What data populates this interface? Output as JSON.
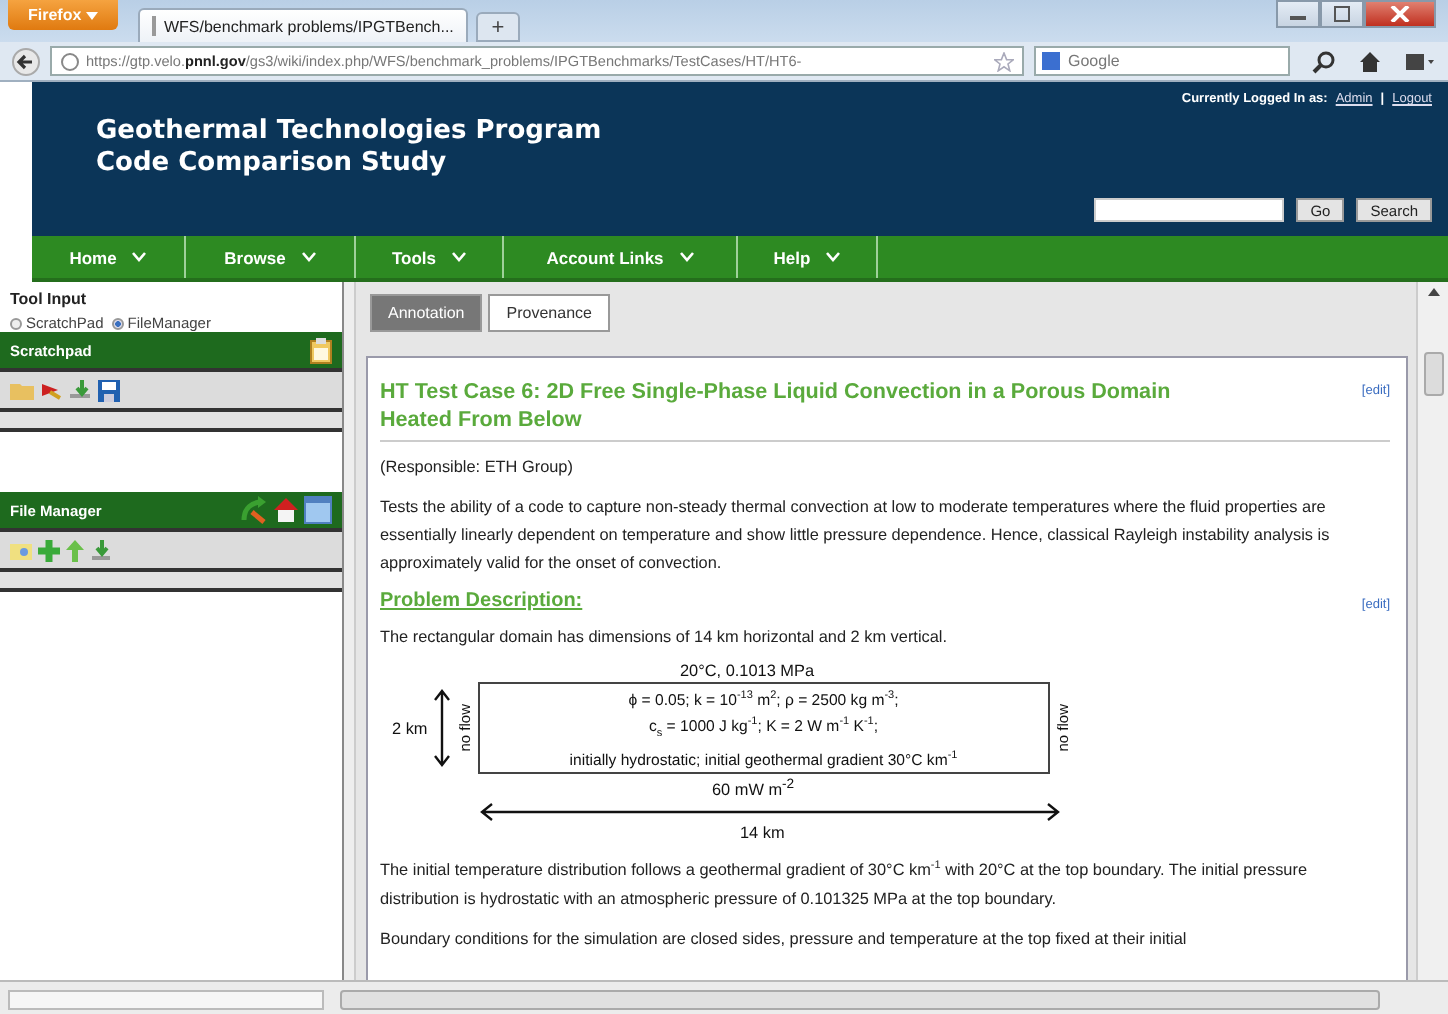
{
  "browser": {
    "menu_button": "Firefox",
    "tab_title": "WFS/benchmark problems/IPGTBench...",
    "new_tab": "+",
    "url": "https://gtp.velo.**pnnl.gov**/gs3/wiki/index.php/WFS/benchmark_problems/IPGTBenchmarks/TestCases/HT/HT6-",
    "search_engine": "Google"
  },
  "header": {
    "title_lines": [
      "Geothermal Technologies Program",
      "Code Comparison Study"
    ],
    "login_label": "Currently Logged In as:",
    "user_link": "Admin",
    "separator": "|",
    "logout_link": "Logout",
    "go_button": "Go",
    "search_button": "Search"
  },
  "nav": [
    {
      "label": "Home"
    },
    {
      "label": "Browse"
    },
    {
      "label": "Tools"
    },
    {
      "label": "Account Links"
    },
    {
      "label": "Help"
    }
  ],
  "sidebar": {
    "tool_input_label": "Tool Input",
    "options": [
      {
        "label": "ScratchPad",
        "selected": false
      },
      {
        "label": "FileManager",
        "selected": true
      }
    ],
    "panels": [
      {
        "title": "Scratchpad"
      },
      {
        "title": "File Manager"
      }
    ]
  },
  "content": {
    "tabs": [
      {
        "label": "Annotation",
        "selected": true
      },
      {
        "label": "Provenance",
        "selected": false
      }
    ],
    "heading": "HT Test Case 6: 2D Free Single-Phase Liquid Convection in a Porous Domain Heated From Below",
    "heading_edit": "[edit]",
    "responsible": "(Responsible: ETH Group)",
    "intro": "Tests the ability of a code to capture non-steady thermal convection at low to moderate temperatures where the fluid properties are essentially linearly dependent on temperature and show little pressure dependence.  Hence, classical Rayleigh instability analysis is approximately valid for the onset of convection.",
    "section_title": "Problem Description:",
    "section_edit": "[edit]",
    "domain_text": "The rectangular domain has dimensions of 14 km horizontal and 2 km vertical.",
    "diagram": {
      "top_label": "20°C, 0.1013 MPa",
      "height_label": "2 km",
      "left_side": "no flow",
      "right_side": "no flow",
      "lines": [
        "ϕ = 0.05; k = 10$^{-13}$ m$^{2}$; ρ = 2500 kg m$^{-3}$;",
        "c$_{s}$ = 1000 J kg$^{-1}$; K = 2 W m$^{-1}$ K$^{-1}$;",
        "initially hydrostatic; initial geothermal gradient 30°C km$^{-1}$"
      ],
      "bottom_label": "60 mW m$^{-2}$",
      "width_label": "14 km"
    },
    "paragraphs": [
      "The initial temperature distribution follows a geothermal gradient of 30°C km$^{-1}$ with 20°C at the top boundary. The initial pressure distribution is hydrostatic with an atmospheric pressure of 0.101325 MPa at the top boundary.",
      "Boundary conditions for the simulation are closed sides, pressure and temperature at the top fixed at their initial"
    ]
  }
}
